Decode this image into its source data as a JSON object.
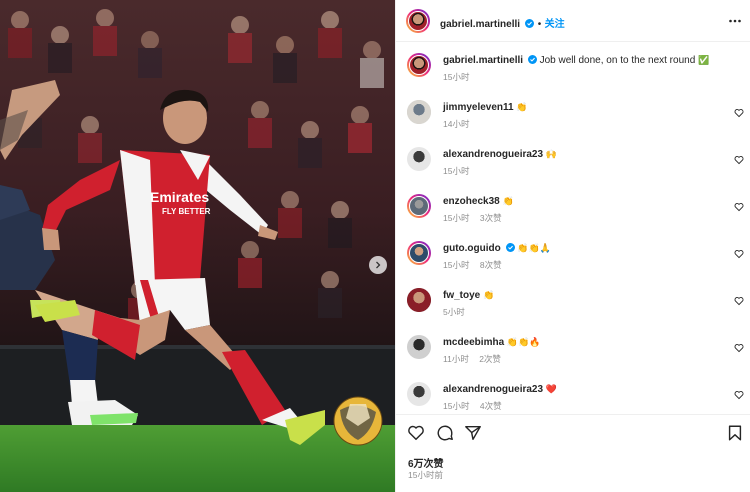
{
  "post": {
    "author": "gabriel.martinelli",
    "follow_label": "关注",
    "caption": "Job well done, on to the next round",
    "caption_emoji": "✅",
    "caption_time": "15小时",
    "likes": "6万次赞",
    "posted_time": "15小时前"
  },
  "comments": [
    {
      "user": "jimmyeleven11",
      "verified": false,
      "emoji": "👏",
      "time": "14小时",
      "likes": ""
    },
    {
      "user": "alexandrenogueira23",
      "verified": false,
      "emoji": "🙌",
      "time": "15小时",
      "likes": ""
    },
    {
      "user": "enzoheck38",
      "verified": false,
      "emoji": "👏",
      "time": "15小时",
      "likes": "3次赞"
    },
    {
      "user": "guto.oguido",
      "verified": true,
      "emoji": "👏👏🙏",
      "time": "15小时",
      "likes": "8次赞"
    },
    {
      "user": "fw_toye",
      "verified": false,
      "emoji": "👏",
      "time": "5小时",
      "likes": ""
    },
    {
      "user": "mcdeebimha",
      "verified": false,
      "emoji": "👏👏🔥",
      "time": "11小时",
      "likes": "2次赞"
    },
    {
      "user": "alexandrenogueira23",
      "verified": false,
      "emoji": "❤️",
      "time": "15小时",
      "likes": "4次赞"
    }
  ],
  "photo": {
    "shirt_sponsor_line1": "Emirates",
    "shirt_sponsor_line2": "FLY BETTER"
  },
  "icons": {
    "like": "heart-icon",
    "comment": "comment-icon",
    "share": "share-icon",
    "save": "bookmark-icon",
    "more": "more-options-icon",
    "verified": "verified-badge-icon",
    "next": "chevron-right-icon"
  },
  "colors": {
    "accent": "#0095f6",
    "verified": "#0095f6",
    "muted": "#8e8e8e",
    "text": "#262626",
    "arsenal_red": "#d0202e",
    "pitch": "#3f8f2f"
  }
}
